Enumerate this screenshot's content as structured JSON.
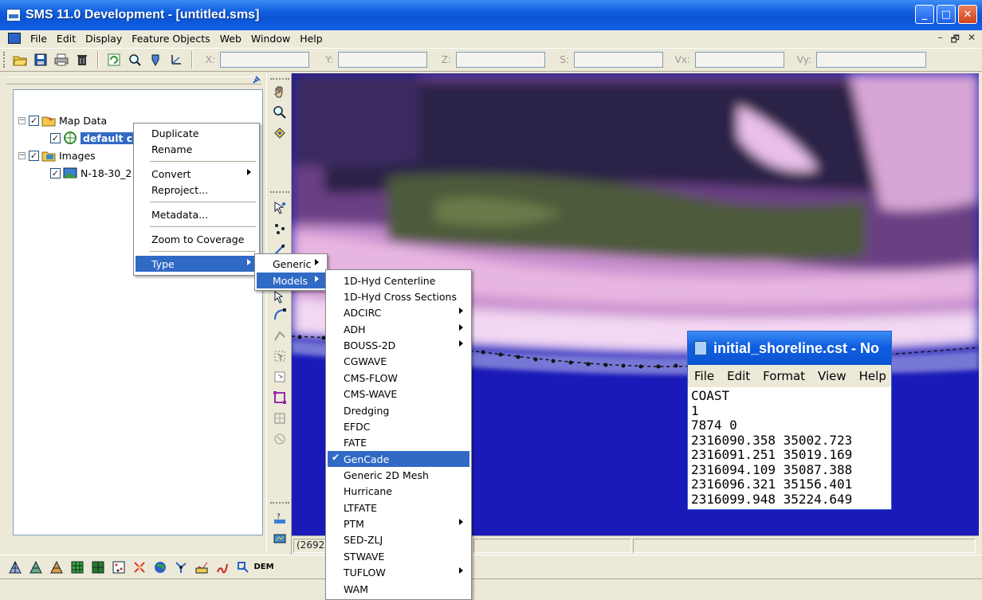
{
  "window": {
    "title": "SMS 11.0 Development - [untitled.sms]",
    "btn_min": "_",
    "btn_max": "□",
    "btn_close": "✕"
  },
  "menubar": {
    "items": [
      "File",
      "Edit",
      "Display",
      "Feature Objects",
      "Web",
      "Window",
      "Help"
    ],
    "mdi_min": "–",
    "mdi_restore": "🗗",
    "mdi_close": "✕"
  },
  "toolbar": {
    "coords": [
      {
        "label": "X:",
        "value": ""
      },
      {
        "label": "Y:",
        "value": ""
      },
      {
        "label": "Z:",
        "value": ""
      },
      {
        "label": "S:",
        "value": ""
      },
      {
        "label": "Vx:",
        "value": ""
      },
      {
        "label": "Vy:",
        "value": ""
      }
    ]
  },
  "tree": {
    "map_data": {
      "label": "Map Data",
      "expander": "−",
      "check": "✓"
    },
    "coverage": {
      "label": "default coverage",
      "check": "✓"
    },
    "images": {
      "label": "Images",
      "expander": "−",
      "check": "✓"
    },
    "image_item": {
      "label": "N-18-30_2",
      "check": "✓"
    }
  },
  "context_menu": {
    "duplicate": "Duplicate",
    "rename": "Rename",
    "convert": "Convert",
    "reproject": "Reproject...",
    "metadata": "Metadata...",
    "zoom": "Zoom to Coverage",
    "type": "Type"
  },
  "type_menu": {
    "generic": "Generic",
    "models": "Models"
  },
  "models_menu": {
    "items": [
      "1D-Hyd Centerline",
      "1D-Hyd Cross Sections",
      "ADCIRC",
      "ADH",
      "BOUSS-2D",
      "CGWAVE",
      "CMS-FLOW",
      "CMS-WAVE",
      "Dredging",
      "EFDC",
      "FATE",
      "GenCade",
      "Generic 2D Mesh",
      "Hurricane",
      "LTFATE",
      "PTM",
      "SED-ZLJ",
      "STWAVE",
      "TUFLOW",
      "WAM"
    ],
    "checked_mark": "✔"
  },
  "status": {
    "coords": "(26922"
  },
  "bottom_toolbar": {
    "dem_label": "DEM"
  },
  "notepad": {
    "title": "initial_shoreline.cst - No",
    "menu": [
      "File",
      "Edit",
      "Format",
      "View",
      "Help"
    ],
    "lines": [
      "COAST",
      "1",
      "7874 0",
      "2316090.358 35002.723",
      "2316091.251 35019.169",
      "2316094.109 35087.388",
      "2316096.321 35156.401",
      "2316099.948 35224.649"
    ]
  }
}
